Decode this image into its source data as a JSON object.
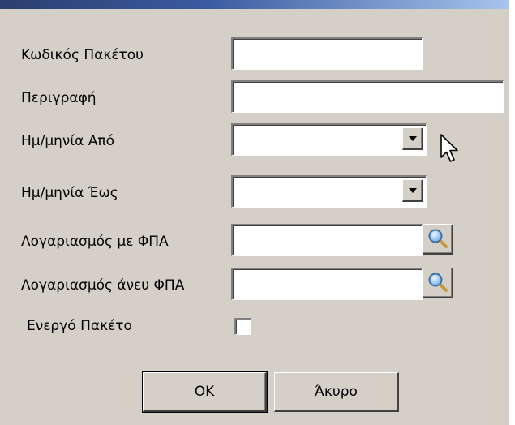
{
  "form": {
    "package_code_label": "Κωδικός Πακέτου",
    "package_code_value": "",
    "description_label": "Περιγραφή",
    "description_value": "",
    "date_from_label": "Ημ/μηνία Από",
    "date_from_value": "",
    "date_to_label": "Ημ/μηνία Έως",
    "date_to_value": "",
    "account_vat_label": "Λογαριασμός με ΦΠΑ",
    "account_vat_value": "",
    "account_novat_label": "Λογαριασμός άνευ ΦΠΑ",
    "account_novat_value": "",
    "active_label": "Ενεργό Πακέτο",
    "active_checked": false
  },
  "buttons": {
    "ok_label": "OK",
    "cancel_label": "Άκυρο"
  },
  "icons": {
    "dropdown": "chevron-down-icon",
    "lookup": "magnifier-icon",
    "cursor": "mouse-pointer-icon"
  },
  "colors": {
    "dialog_bg": "#d4d0c8",
    "field_bg": "#ffffff",
    "title_gradient_start": "#2b3f6e",
    "title_gradient_end": "#a6c4ec"
  }
}
